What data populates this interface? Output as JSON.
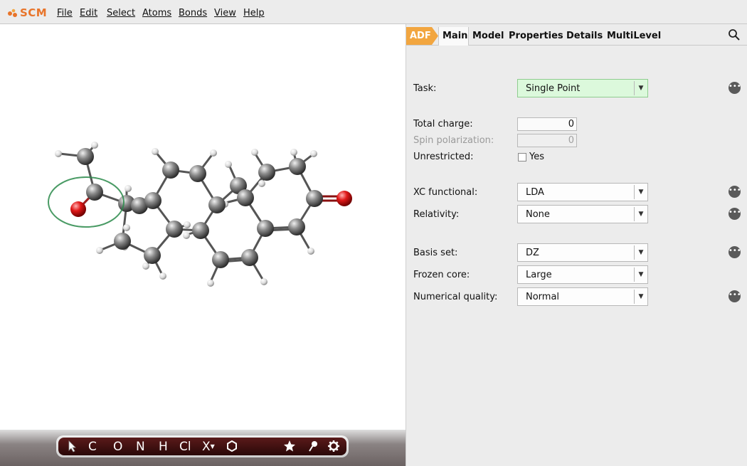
{
  "app": {
    "logo_text": "SCM"
  },
  "menu": [
    {
      "label": "File"
    },
    {
      "label": "Edit"
    },
    {
      "label": "Select"
    },
    {
      "label": "Atoms"
    },
    {
      "label": "Bonds"
    },
    {
      "label": "View"
    },
    {
      "label": "Help"
    }
  ],
  "tabs": {
    "engine": "ADF",
    "items": [
      {
        "label": "Main"
      },
      {
        "label": "Model"
      },
      {
        "label": "Properties"
      },
      {
        "label": "Details"
      },
      {
        "label": "MultiLevel"
      }
    ],
    "active": "Main"
  },
  "form": {
    "task": {
      "label": "Task:",
      "value": "Single Point"
    },
    "total_charge": {
      "label": "Total charge:",
      "value": "0"
    },
    "spin_polarization": {
      "label": "Spin polarization:",
      "value": "0"
    },
    "unrestricted": {
      "label": "Unrestricted:",
      "checkbox_label": "Yes",
      "checked": false
    },
    "xc_functional": {
      "label": "XC functional:",
      "value": "LDA"
    },
    "relativity": {
      "label": "Relativity:",
      "value": "None"
    },
    "basis_set": {
      "label": "Basis set:",
      "value": "DZ"
    },
    "frozen_core": {
      "label": "Frozen core:",
      "value": "Large"
    },
    "numerical_quality": {
      "label": "Numerical quality:",
      "value": "Normal"
    }
  },
  "toolbar": {
    "tools": [
      {
        "icon": "select-arrow-icon"
      },
      {
        "label": "C"
      },
      {
        "label": "O"
      },
      {
        "label": "N"
      },
      {
        "label": "H"
      },
      {
        "label": "Cl"
      },
      {
        "label": "X"
      },
      {
        "icon": "ring-icon"
      },
      {
        "icon": "star-icon"
      },
      {
        "icon": "pin-icon"
      },
      {
        "icon": "gear-icon"
      }
    ]
  },
  "colors": {
    "accent": "#f2a640",
    "brand": "#e8742a",
    "task_bg": "#dcf9dc"
  }
}
